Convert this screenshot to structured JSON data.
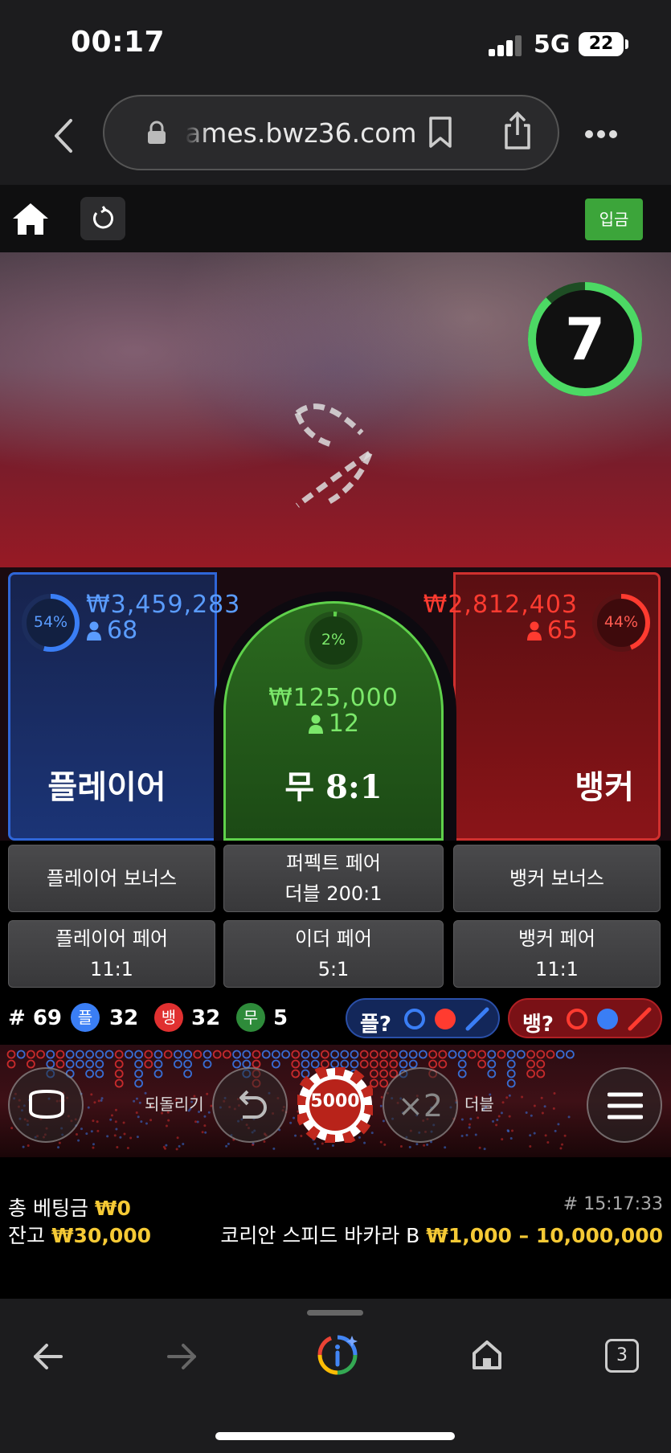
{
  "status_bar": {
    "time": "00:17",
    "network": "5G",
    "battery": "22"
  },
  "browser": {
    "url": "ames.bwz36.com",
    "tab_count": "3"
  },
  "game_header": {
    "deposit_label": "입금"
  },
  "timer": {
    "seconds": "7",
    "progress": 0.88
  },
  "bets": {
    "player": {
      "title": "플레이어",
      "percent": "54%",
      "percent_value": 0.54,
      "amount": "₩3,459,283",
      "players": "68"
    },
    "tie": {
      "title": "무 8:1",
      "percent": "2%",
      "percent_value": 0.02,
      "amount": "₩125,000",
      "players": "12"
    },
    "banker": {
      "title": "뱅커",
      "percent": "44%",
      "percent_value": 0.44,
      "amount": "₩2,812,403",
      "players": "65"
    }
  },
  "side_bets": [
    {
      "line1": "플레이어 보너스",
      "line2": ""
    },
    {
      "line1": "퍼펙트 페어",
      "line2": "더블 200:1"
    },
    {
      "line1": "뱅커 보너스",
      "line2": ""
    },
    {
      "line1": "플레이어 페어",
      "line2": "11:1"
    },
    {
      "line1": "이더 페어",
      "line2": "5:1"
    },
    {
      "line1": "뱅커 페어",
      "line2": "11:1"
    }
  ],
  "stats": {
    "round": "# 69",
    "player_badge": "플",
    "player_count": "32",
    "banker_badge": "뱅",
    "banker_count": "32",
    "tie_badge": "무",
    "tie_count": "5",
    "player_predict": "플?",
    "banker_predict": "뱅?"
  },
  "controls": {
    "undo_label": "되돌리기",
    "chip_value": "5000",
    "double_symbol": "×2",
    "double_label": "더블"
  },
  "info": {
    "total_bet_label": "총 베팅금",
    "total_bet_value": "₩0",
    "balance_label": "잔고",
    "balance_value": "₩30,000",
    "timestamp": "# 15:17:33",
    "table_name": "코리안 스피드 바카라 B",
    "limits": "₩1,000 – 10,000,000"
  },
  "colors": {
    "player": "#2f66d8",
    "banker": "#d0302e",
    "tie": "#5fd14b",
    "accent": "#f5c935",
    "deposit": "#3ca53a"
  }
}
